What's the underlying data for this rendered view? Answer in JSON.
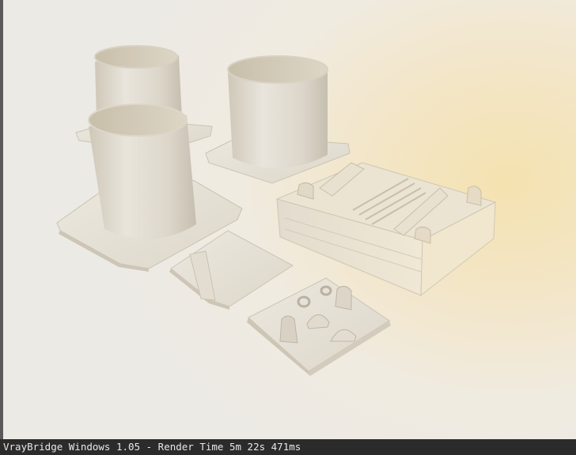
{
  "statusbar": {
    "text": "VrayBridge Windows 1.05 - Render Time 5m 22s 471ms"
  },
  "colors": {
    "window_bg": "#3a3a3a",
    "status_bg": "#2b2b2b",
    "status_text": "#e8e8e8",
    "model_light": "#e6e1d6",
    "model_mid": "#d6cfc1",
    "model_shadow": "#bfb7a8",
    "interior": "#cfc6b2"
  }
}
